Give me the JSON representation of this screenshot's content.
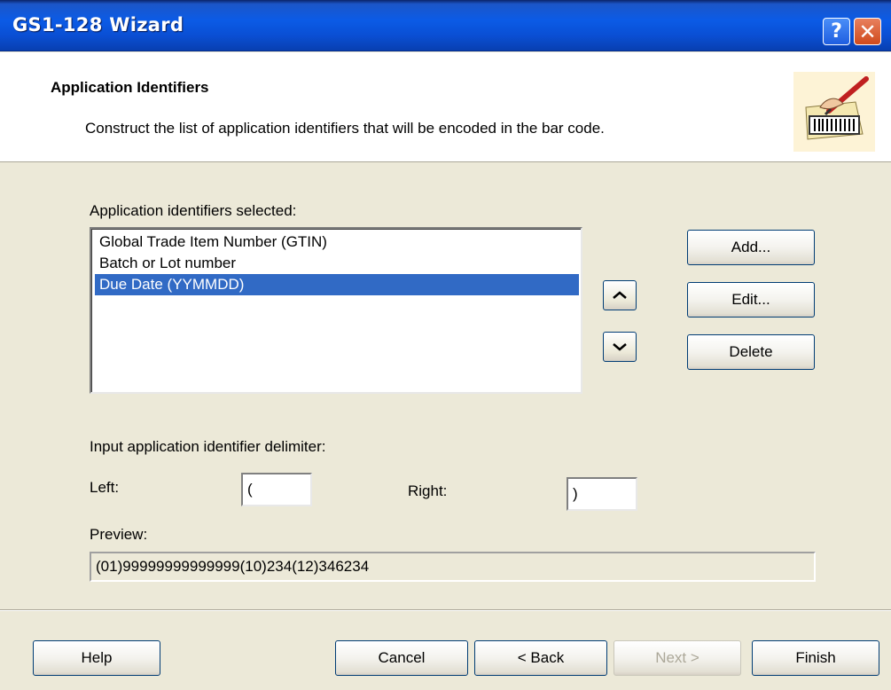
{
  "window": {
    "title": "GS1-128 Wizard",
    "help_glyph": "?",
    "close_glyph": "✕"
  },
  "header": {
    "title": "Application Identifiers",
    "subtitle": "Construct the list of application identifiers that will be encoded in the bar code.",
    "icon": "barcode-pen-icon"
  },
  "identifiers": {
    "label": "Application identifiers selected:",
    "items": [
      "Global Trade Item Number (GTIN)",
      "Batch or Lot number",
      "Due Date (YYMMDD)"
    ],
    "selected_index": 2
  },
  "buttons": {
    "add": "Add...",
    "edit": "Edit...",
    "delete": "Delete",
    "help": "Help",
    "cancel": "Cancel",
    "back": "< Back",
    "next": "Next >",
    "finish": "Finish"
  },
  "delimiter": {
    "label": "Input application identifier delimiter:",
    "left_label": "Left:",
    "left_value": "(",
    "right_label": "Right:",
    "right_value": ")"
  },
  "preview": {
    "label": "Preview:",
    "value": "(01)99999999999999(10)234(12)346234"
  },
  "colors": {
    "title_bar": "#0a4fd4",
    "selection": "#316ac5",
    "dialog_bg": "#ece9d8"
  }
}
